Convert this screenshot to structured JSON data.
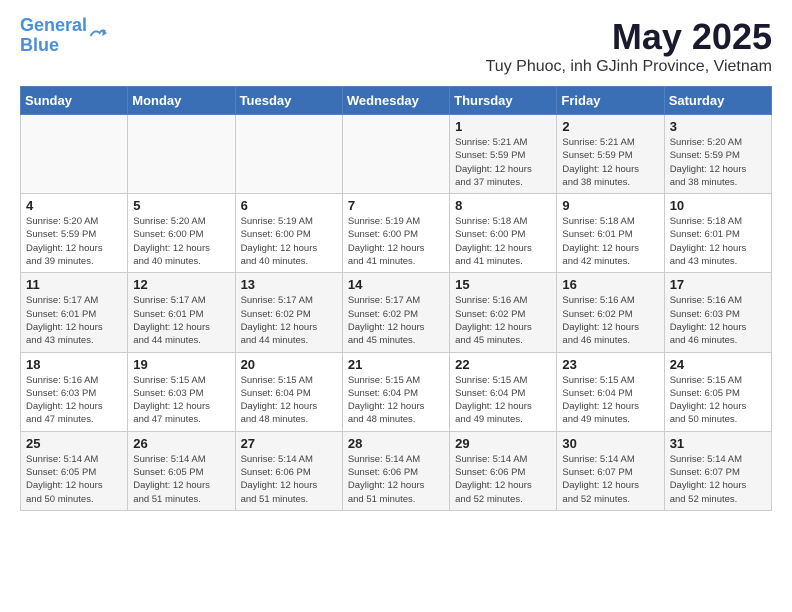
{
  "header": {
    "logo_line1": "General",
    "logo_line2": "Blue",
    "title": "May 2025",
    "subtitle": "Tuy Phuoc, inh GJinh Province, Vietnam"
  },
  "weekdays": [
    "Sunday",
    "Monday",
    "Tuesday",
    "Wednesday",
    "Thursday",
    "Friday",
    "Saturday"
  ],
  "weeks": [
    [
      {
        "day": "",
        "info": ""
      },
      {
        "day": "",
        "info": ""
      },
      {
        "day": "",
        "info": ""
      },
      {
        "day": "",
        "info": ""
      },
      {
        "day": "1",
        "info": "Sunrise: 5:21 AM\nSunset: 5:59 PM\nDaylight: 12 hours\nand 37 minutes."
      },
      {
        "day": "2",
        "info": "Sunrise: 5:21 AM\nSunset: 5:59 PM\nDaylight: 12 hours\nand 38 minutes."
      },
      {
        "day": "3",
        "info": "Sunrise: 5:20 AM\nSunset: 5:59 PM\nDaylight: 12 hours\nand 38 minutes."
      }
    ],
    [
      {
        "day": "4",
        "info": "Sunrise: 5:20 AM\nSunset: 5:59 PM\nDaylight: 12 hours\nand 39 minutes."
      },
      {
        "day": "5",
        "info": "Sunrise: 5:20 AM\nSunset: 6:00 PM\nDaylight: 12 hours\nand 40 minutes."
      },
      {
        "day": "6",
        "info": "Sunrise: 5:19 AM\nSunset: 6:00 PM\nDaylight: 12 hours\nand 40 minutes."
      },
      {
        "day": "7",
        "info": "Sunrise: 5:19 AM\nSunset: 6:00 PM\nDaylight: 12 hours\nand 41 minutes."
      },
      {
        "day": "8",
        "info": "Sunrise: 5:18 AM\nSunset: 6:00 PM\nDaylight: 12 hours\nand 41 minutes."
      },
      {
        "day": "9",
        "info": "Sunrise: 5:18 AM\nSunset: 6:01 PM\nDaylight: 12 hours\nand 42 minutes."
      },
      {
        "day": "10",
        "info": "Sunrise: 5:18 AM\nSunset: 6:01 PM\nDaylight: 12 hours\nand 43 minutes."
      }
    ],
    [
      {
        "day": "11",
        "info": "Sunrise: 5:17 AM\nSunset: 6:01 PM\nDaylight: 12 hours\nand 43 minutes."
      },
      {
        "day": "12",
        "info": "Sunrise: 5:17 AM\nSunset: 6:01 PM\nDaylight: 12 hours\nand 44 minutes."
      },
      {
        "day": "13",
        "info": "Sunrise: 5:17 AM\nSunset: 6:02 PM\nDaylight: 12 hours\nand 44 minutes."
      },
      {
        "day": "14",
        "info": "Sunrise: 5:17 AM\nSunset: 6:02 PM\nDaylight: 12 hours\nand 45 minutes."
      },
      {
        "day": "15",
        "info": "Sunrise: 5:16 AM\nSunset: 6:02 PM\nDaylight: 12 hours\nand 45 minutes."
      },
      {
        "day": "16",
        "info": "Sunrise: 5:16 AM\nSunset: 6:02 PM\nDaylight: 12 hours\nand 46 minutes."
      },
      {
        "day": "17",
        "info": "Sunrise: 5:16 AM\nSunset: 6:03 PM\nDaylight: 12 hours\nand 46 minutes."
      }
    ],
    [
      {
        "day": "18",
        "info": "Sunrise: 5:16 AM\nSunset: 6:03 PM\nDaylight: 12 hours\nand 47 minutes."
      },
      {
        "day": "19",
        "info": "Sunrise: 5:15 AM\nSunset: 6:03 PM\nDaylight: 12 hours\nand 47 minutes."
      },
      {
        "day": "20",
        "info": "Sunrise: 5:15 AM\nSunset: 6:04 PM\nDaylight: 12 hours\nand 48 minutes."
      },
      {
        "day": "21",
        "info": "Sunrise: 5:15 AM\nSunset: 6:04 PM\nDaylight: 12 hours\nand 48 minutes."
      },
      {
        "day": "22",
        "info": "Sunrise: 5:15 AM\nSunset: 6:04 PM\nDaylight: 12 hours\nand 49 minutes."
      },
      {
        "day": "23",
        "info": "Sunrise: 5:15 AM\nSunset: 6:04 PM\nDaylight: 12 hours\nand 49 minutes."
      },
      {
        "day": "24",
        "info": "Sunrise: 5:15 AM\nSunset: 6:05 PM\nDaylight: 12 hours\nand 50 minutes."
      }
    ],
    [
      {
        "day": "25",
        "info": "Sunrise: 5:14 AM\nSunset: 6:05 PM\nDaylight: 12 hours\nand 50 minutes."
      },
      {
        "day": "26",
        "info": "Sunrise: 5:14 AM\nSunset: 6:05 PM\nDaylight: 12 hours\nand 51 minutes."
      },
      {
        "day": "27",
        "info": "Sunrise: 5:14 AM\nSunset: 6:06 PM\nDaylight: 12 hours\nand 51 minutes."
      },
      {
        "day": "28",
        "info": "Sunrise: 5:14 AM\nSunset: 6:06 PM\nDaylight: 12 hours\nand 51 minutes."
      },
      {
        "day": "29",
        "info": "Sunrise: 5:14 AM\nSunset: 6:06 PM\nDaylight: 12 hours\nand 52 minutes."
      },
      {
        "day": "30",
        "info": "Sunrise: 5:14 AM\nSunset: 6:07 PM\nDaylight: 12 hours\nand 52 minutes."
      },
      {
        "day": "31",
        "info": "Sunrise: 5:14 AM\nSunset: 6:07 PM\nDaylight: 12 hours\nand 52 minutes."
      }
    ]
  ]
}
